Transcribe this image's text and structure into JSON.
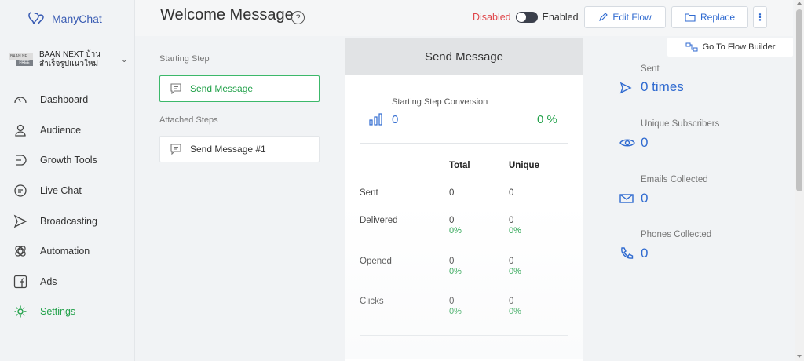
{
  "app": {
    "name": "ManyChat"
  },
  "account": {
    "badge_top": "BAAN NE",
    "badge_plan": "FREE",
    "name": "BAAN NEXT บ้าน สำเร็จรูปแนวใหม่"
  },
  "sidebar": {
    "items": [
      {
        "label": "Dashboard",
        "icon": "gauge-icon"
      },
      {
        "label": "Audience",
        "icon": "user-icon"
      },
      {
        "label": "Growth Tools",
        "icon": "growth-icon"
      },
      {
        "label": "Live Chat",
        "icon": "chat-icon"
      },
      {
        "label": "Broadcasting",
        "icon": "send-icon"
      },
      {
        "label": "Automation",
        "icon": "automation-icon"
      },
      {
        "label": "Ads",
        "icon": "facebook-icon"
      },
      {
        "label": "Settings",
        "icon": "gear-icon",
        "active": true
      }
    ]
  },
  "header": {
    "title": "Welcome Message",
    "toggle": {
      "disabled_label": "Disabled",
      "enabled_label": "Enabled",
      "state": "disabled"
    },
    "edit_flow_label": "Edit Flow",
    "replace_label": "Replace",
    "more_label": "⋮",
    "flow_builder_label": "Go To Flow Builder"
  },
  "steps": {
    "starting_label": "Starting Step",
    "starting_step": "Send Message",
    "attached_label": "Attached Steps",
    "attached_step": "Send Message #1"
  },
  "panel": {
    "title": "Send Message",
    "conversion_label": "Starting Step Conversion",
    "conversion_value": "0",
    "conversion_pct": "0 %",
    "col_total": "Total",
    "col_unique": "Unique",
    "rows": [
      {
        "label": "Sent",
        "total": "0",
        "unique": "0"
      },
      {
        "label": "Delivered",
        "total": "0",
        "total_pct": "0%",
        "unique": "0",
        "unique_pct": "0%"
      },
      {
        "label": "Opened",
        "total": "0",
        "total_pct": "0%",
        "unique": "0",
        "unique_pct": "0%"
      },
      {
        "label": "Clicks",
        "total": "0",
        "total_pct": "0%",
        "unique": "0",
        "unique_pct": "0%"
      }
    ]
  },
  "stats": {
    "sent_label": "Sent",
    "sent_value": "0 times",
    "unique_label": "Unique Subscribers",
    "unique_value": "0",
    "emails_label": "Emails Collected",
    "emails_value": "0",
    "phones_label": "Phones Collected",
    "phones_value": "0"
  },
  "colors": {
    "accent_blue": "#2f6ad0",
    "accent_green": "#22a14a",
    "danger_red": "#e0474b"
  }
}
